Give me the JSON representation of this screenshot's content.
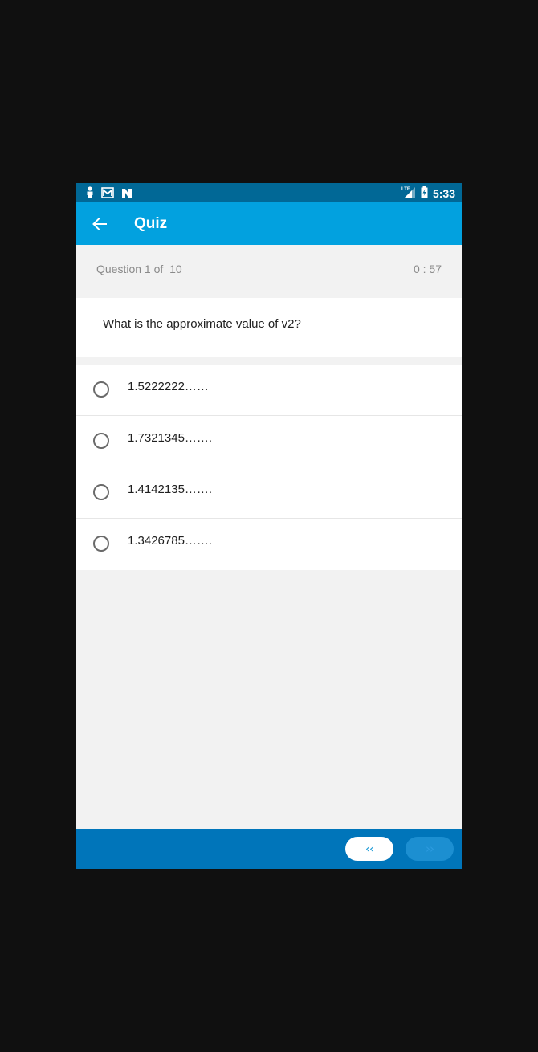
{
  "status_bar": {
    "time": "5:33",
    "network_label": "LTE",
    "icons": [
      "person-notification-icon",
      "image-mail-notification-icon",
      "n-app-notification-icon",
      "lte-signal-icon",
      "battery-charging-icon"
    ]
  },
  "app_bar": {
    "title": "Quiz",
    "back_icon": "arrow-left-icon"
  },
  "question_header": {
    "counter_prefix": "Question 1 of  ",
    "total": "10",
    "timer": "0 : 57"
  },
  "question": {
    "text": "What is the approximate value of v2?"
  },
  "options": [
    {
      "label": "1.5222222……"
    },
    {
      "label": "1.7321345……."
    },
    {
      "label": "1.4142135……."
    },
    {
      "label": "1.3426785……."
    }
  ],
  "navigation": {
    "prev_label": "‹‹",
    "next_label": "››"
  },
  "colors": {
    "status_bar": "#016896",
    "app_bar": "#02a1df",
    "bottom_bar": "#0075ba",
    "background": "#f2f2f2"
  }
}
